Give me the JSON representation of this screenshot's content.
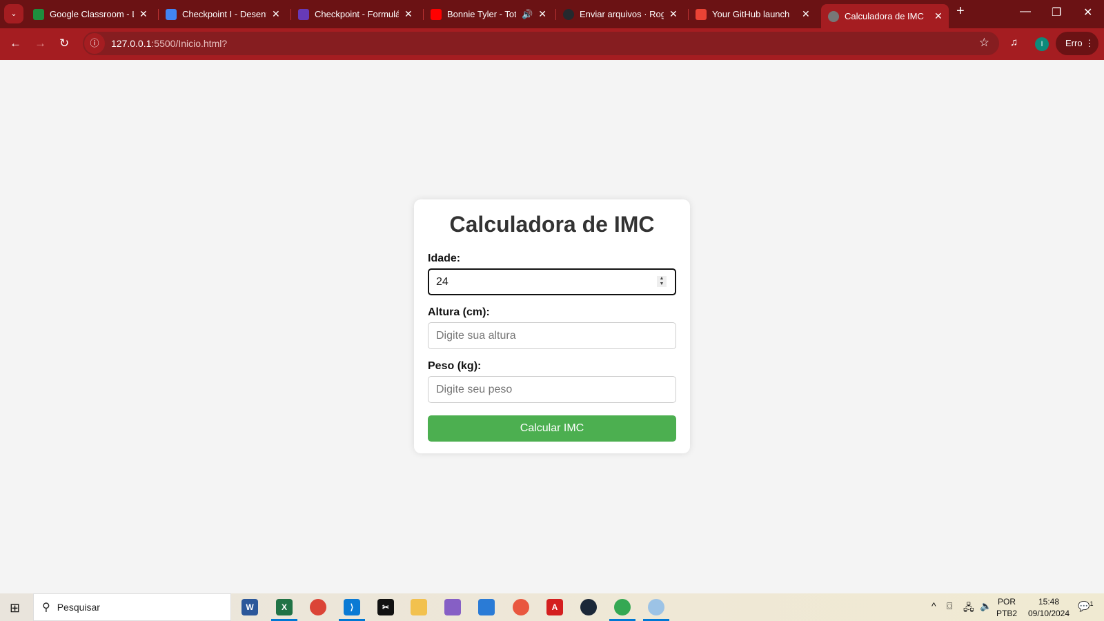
{
  "browser": {
    "tabs": [
      {
        "title": "Google Classroom - Lo",
        "color": "#1e8e3e"
      },
      {
        "title": "Checkpoint I - Desenvo",
        "color": "#4285f4"
      },
      {
        "title": "Checkpoint - Formulári",
        "color": "#673ab7"
      },
      {
        "title": "Bonnie Tyler - Total",
        "color": "#ff0000",
        "audio": "speaker-icon"
      },
      {
        "title": "Enviar arquivos · Rogig",
        "color": "#24292e"
      },
      {
        "title": "Your GitHub launch",
        "color": "#ea4335"
      },
      {
        "title": "Calculadora de IMC",
        "color": "#777777",
        "active": true
      }
    ],
    "url_host": "127.0.0.1",
    "url_rest": ":5500/Inicio.html?",
    "profile_initial": "I",
    "profile_label": "Erro",
    "theme_color": "#a51d21"
  },
  "page": {
    "title": "Calculadora de IMC",
    "fields": [
      {
        "label": "Idade:",
        "value": "24",
        "placeholder": ""
      },
      {
        "label": "Altura (cm):",
        "value": "",
        "placeholder": "Digite sua altura"
      },
      {
        "label": "Peso (kg):",
        "value": "",
        "placeholder": "Digite seu peso"
      }
    ],
    "button": "Calcular IMC",
    "button_color": "#4caf50"
  },
  "taskbar": {
    "search_placeholder": "Pesquisar",
    "apps": [
      "Word",
      "Excel",
      "Chrome",
      "VS Code",
      "CapCut",
      "File Explorer",
      "Visual Studio",
      "App",
      "App",
      "Acrobat",
      "Steam",
      "Chrome",
      "Paint"
    ],
    "lang1": "POR",
    "lang2": "PTB2",
    "time": "15:48",
    "date": "09/10/2024",
    "notifications": "1"
  }
}
